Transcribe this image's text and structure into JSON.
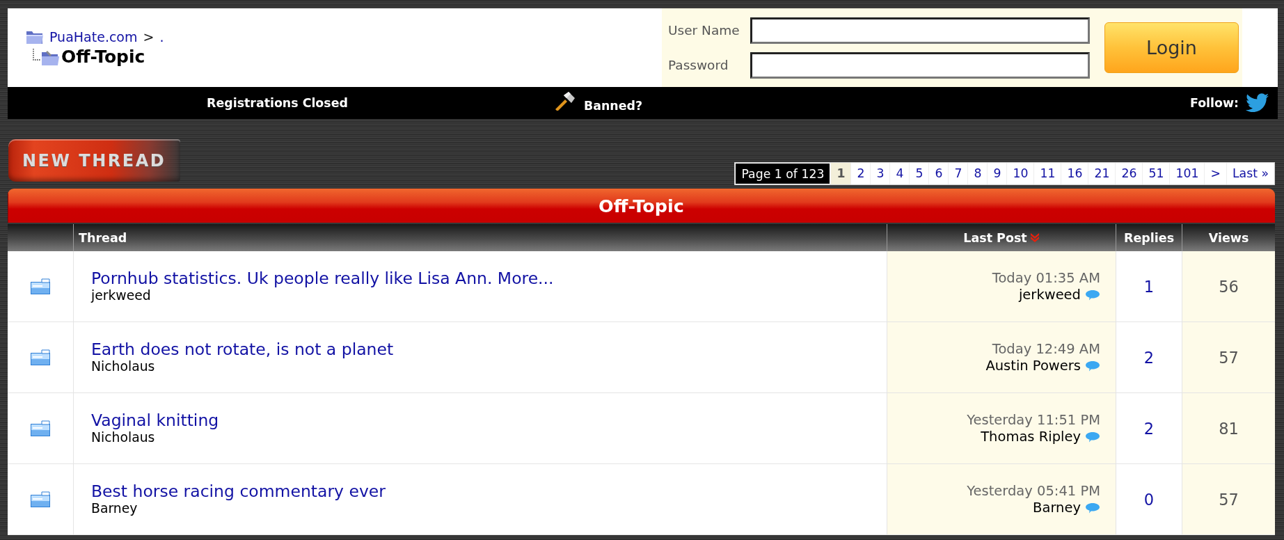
{
  "breadcrumb": {
    "site": "PuaHate.com",
    "separator": ">",
    "parent": ".",
    "current": "Off-Topic"
  },
  "login": {
    "fields": [
      {
        "label": "User Name"
      },
      {
        "label": "Password"
      }
    ],
    "button": "Login"
  },
  "nav_bar": [
    {
      "kind": "notice",
      "label": "Registrations Closed"
    },
    {
      "kind": "banned",
      "label": "Banned?"
    },
    {
      "kind": "follow",
      "label": "Follow:"
    }
  ],
  "new_thread_button": "NEW THREAD",
  "pagination": {
    "summary": "Page 1 of 123",
    "pages": [
      {
        "label": "1",
        "selected": true
      },
      {
        "label": "2",
        "selected": false
      },
      {
        "label": "3",
        "selected": false
      },
      {
        "label": "4",
        "selected": false
      },
      {
        "label": "5",
        "selected": false
      },
      {
        "label": "6",
        "selected": false
      },
      {
        "label": "7",
        "selected": false
      },
      {
        "label": "8",
        "selected": false
      },
      {
        "label": "9",
        "selected": false
      },
      {
        "label": "10",
        "selected": false
      },
      {
        "label": "11",
        "selected": false
      },
      {
        "label": "16",
        "selected": false
      },
      {
        "label": "21",
        "selected": false
      },
      {
        "label": "26",
        "selected": false
      },
      {
        "label": "51",
        "selected": false
      },
      {
        "label": "101",
        "selected": false
      },
      {
        "label": ">",
        "selected": false
      },
      {
        "label": "Last »",
        "selected": false
      }
    ]
  },
  "forum": {
    "title": "Off-Topic",
    "columns": [
      {
        "label": "Thread",
        "sorted": false
      },
      {
        "label": "Last Post",
        "sorted": true
      },
      {
        "label": "Replies",
        "sorted": false
      },
      {
        "label": "Views",
        "sorted": false
      }
    ],
    "threads": [
      {
        "title": "Pornhub statistics. Uk people really like Lisa Ann. More...",
        "author": "jerkweed",
        "last_post_time": "Today 01:35 AM",
        "last_post_by": "jerkweed",
        "replies": "1",
        "views": "56"
      },
      {
        "title": "Earth does not rotate, is not a planet",
        "author": "Nicholaus",
        "last_post_time": "Today 12:49 AM",
        "last_post_by": "Austin Powers",
        "replies": "2",
        "views": "57"
      },
      {
        "title": "Vaginal knitting",
        "author": "Nicholaus",
        "last_post_time": "Yesterday 11:51 PM",
        "last_post_by": "Thomas Ripley",
        "replies": "2",
        "views": "81"
      },
      {
        "title": "Best horse racing commentary ever",
        "author": "Barney",
        "last_post_time": "Yesterday 05:41 PM",
        "last_post_by": "Barney",
        "replies": "0",
        "views": "57"
      }
    ]
  }
}
